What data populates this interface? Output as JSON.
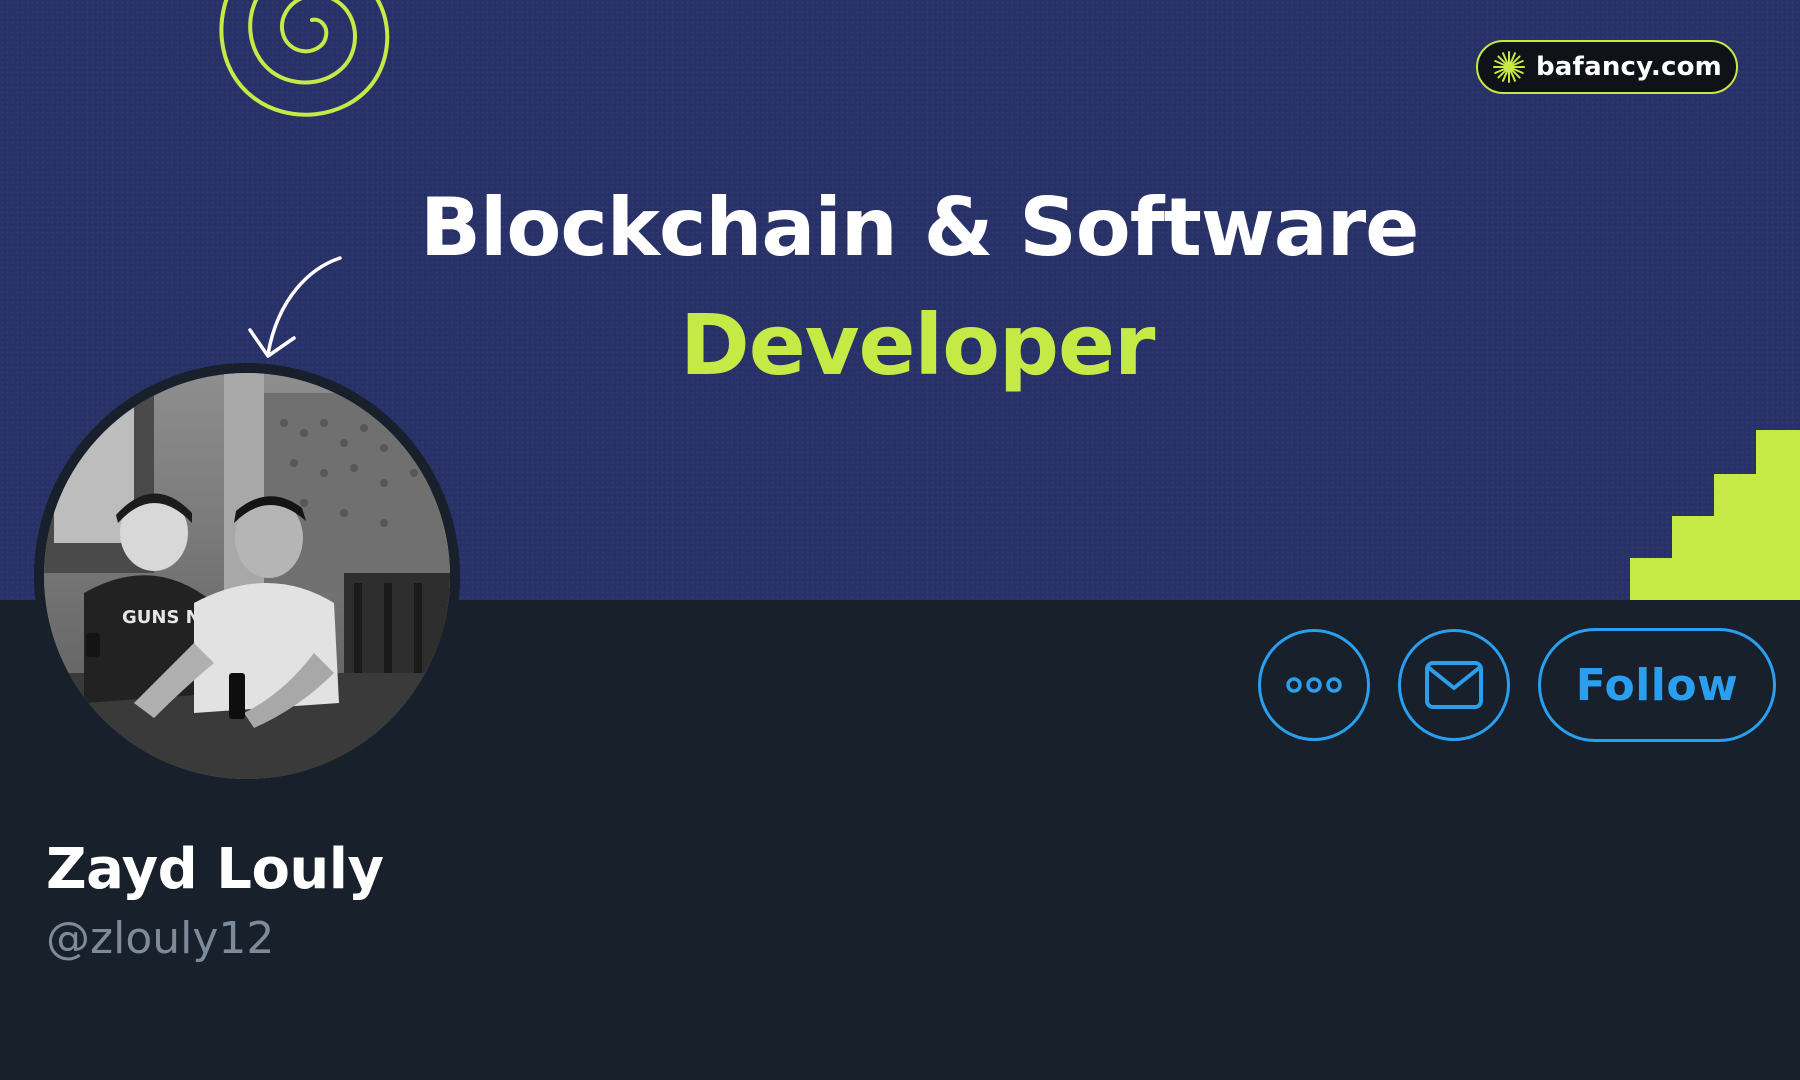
{
  "banner": {
    "headline": "Blockchain & Software",
    "subline": "Developer",
    "brand": {
      "icon": "sunburst-icon",
      "label": "bafancy.com"
    },
    "colors": {
      "background": "#283268",
      "accent": "#c6ea45"
    }
  },
  "profile": {
    "name": "Zayd Louly",
    "handle": "@zlouly12",
    "avatar_icon": "profile-photo"
  },
  "actions": {
    "more_icon": "more-icon",
    "message_icon": "mail-icon",
    "follow_label": "Follow",
    "accent": "#2a9ff0"
  }
}
